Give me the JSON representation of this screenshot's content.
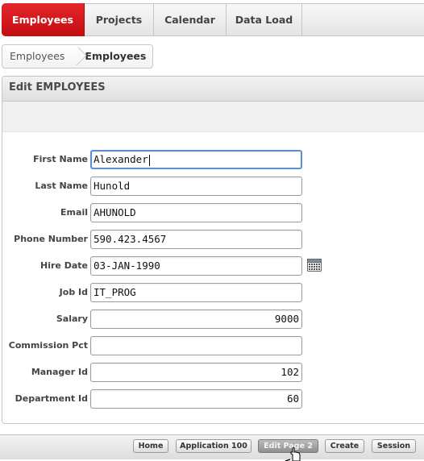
{
  "tabs": [
    {
      "label": "Employees",
      "active": true
    },
    {
      "label": "Projects",
      "active": false
    },
    {
      "label": "Calendar",
      "active": false
    },
    {
      "label": "Data Load",
      "active": false
    }
  ],
  "breadcrumb": {
    "parent": "Employees",
    "current": "Employees"
  },
  "region": {
    "title": "Edit EMPLOYEES"
  },
  "form": {
    "fields": [
      {
        "label": "First Name",
        "value": "Alexander",
        "align": "left",
        "focused": true
      },
      {
        "label": "Last Name",
        "value": "Hunold",
        "align": "left"
      },
      {
        "label": "Email",
        "value": "AHUNOLD",
        "align": "left"
      },
      {
        "label": "Phone Number",
        "value": "590.423.4567",
        "align": "left"
      },
      {
        "label": "Hire Date",
        "value": "03-JAN-1990",
        "align": "left",
        "icon": "calendar-icon"
      },
      {
        "label": "Job Id",
        "value": "IT_PROG",
        "align": "left"
      },
      {
        "label": "Salary",
        "value": "9000",
        "align": "right"
      },
      {
        "label": "Commission Pct",
        "value": "",
        "align": "left"
      },
      {
        "label": "Manager Id",
        "value": "102",
        "align": "right"
      },
      {
        "label": "Department Id",
        "value": "60",
        "align": "right"
      }
    ]
  },
  "devbar": {
    "buttons": [
      "Home",
      "Application 100",
      "Edit Page 2",
      "Create",
      "Session"
    ],
    "hovered": "Edit Page 2"
  },
  "colors": {
    "active_tab": "#d3181c",
    "focus_border": "#5a8ed6"
  }
}
